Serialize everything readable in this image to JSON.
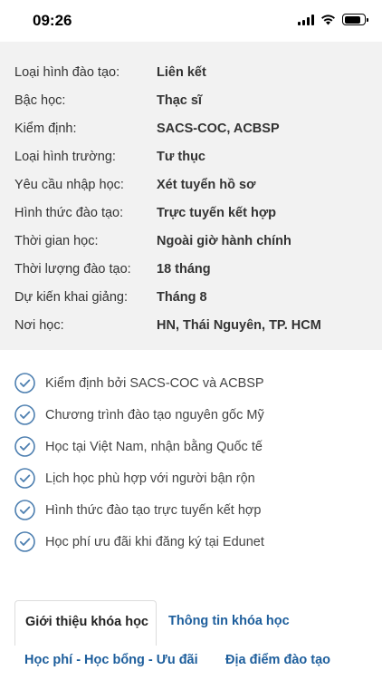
{
  "status_bar": {
    "time": "09:26"
  },
  "info": [
    {
      "label": "Loại hình đào tạo:",
      "value": "Liên kết"
    },
    {
      "label": "Bậc học:",
      "value": "Thạc sĩ"
    },
    {
      "label": "Kiểm định:",
      "value": "SACS-COC, ACBSP"
    },
    {
      "label": "Loại hình trường:",
      "value": "Tư thục"
    },
    {
      "label": "Yêu cầu nhập học:",
      "value": "Xét tuyển hồ sơ"
    },
    {
      "label": "Hình thức đào tạo:",
      "value": "Trực tuyến kết hợp"
    },
    {
      "label": "Thời gian học:",
      "value": "Ngoài giờ hành chính"
    },
    {
      "label": "Thời lượng đào tạo:",
      "value": "18 tháng"
    },
    {
      "label": "Dự kiến khai giảng:",
      "value": "Tháng 8"
    },
    {
      "label": "Nơi học:",
      "value": "HN, Thái Nguyên, TP. HCM"
    }
  ],
  "features": [
    "Kiểm định bởi SACS-COC và ACBSP",
    "Chương trình đào tạo nguyên gốc Mỹ",
    "Học tại Việt Nam, nhận bằng Quốc tế",
    "Lịch học phù hợp với người bận rộn",
    "Hình thức đào tạo trực tuyến kết hợp",
    "Học phí ưu đãi khi đăng ký tại Edunet"
  ],
  "tabs": {
    "intro": "Giới thiệu khóa học",
    "info": "Thông tin khóa học",
    "fees": "Học phí - Học bổng - Ưu đãi",
    "location": "Địa điểm đào tạo"
  },
  "colors": {
    "accent": "#1d5e9c",
    "check": "#4d7fb0",
    "panel": "#f2f2f2"
  }
}
